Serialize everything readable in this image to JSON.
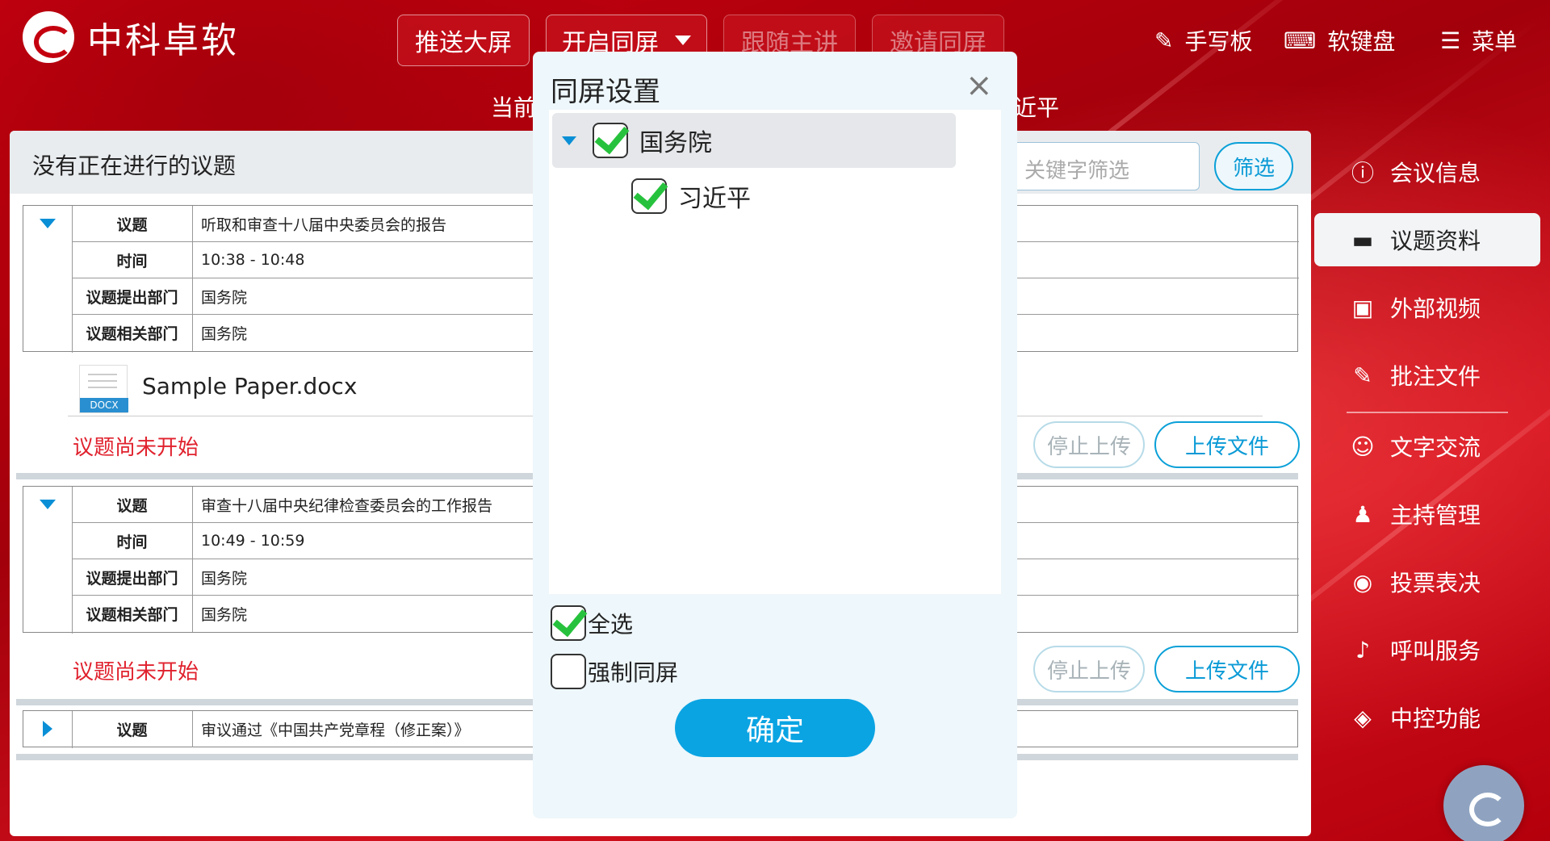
{
  "app": {
    "name": "中科卓软"
  },
  "topbar": {
    "buttons": [
      {
        "label": "推送大屏",
        "enabled": true
      },
      {
        "label": "开启同屏",
        "enabled": true
      },
      {
        "label": "跟随主讲",
        "enabled": false
      },
      {
        "label": "邀请同屏",
        "enabled": false
      }
    ],
    "tools": [
      {
        "label": "手写板",
        "icon": "edit-icon"
      },
      {
        "label": "软键盘",
        "icon": "keyboard-icon"
      },
      {
        "label": "菜单",
        "icon": "menu-icon"
      }
    ],
    "current_prefix": "当前",
    "current_suffix": "近平"
  },
  "panel": {
    "title": "没有正在进行的议题",
    "keyword_placeholder": "关键字筛选",
    "filter_label": "筛选"
  },
  "agenda": {
    "labels": {
      "topic": "议题",
      "time": "时间",
      "proposer": "议题提出部门",
      "related": "议题相关部门"
    },
    "items": [
      {
        "topic": "听取和审查十八届中央委员会的报告",
        "time": "10:38 - 10:48",
        "proposer": "国务院",
        "related": "国务院",
        "file": "Sample Paper.docx",
        "file_type": "DOCX",
        "status": "议题尚未开始"
      },
      {
        "topic": "审查十八届中央纪律检查委员会的工作报告",
        "time": "10:49 - 10:59",
        "proposer": "国务院",
        "related": "国务院",
        "status": "议题尚未开始"
      },
      {
        "topic": "审议通过《中国共产党章程（修正案）》"
      }
    ],
    "stop_upload": "停止上传",
    "upload_file": "上传文件"
  },
  "sidebar": {
    "items": [
      {
        "label": "会议信息",
        "icon": "info-icon"
      },
      {
        "label": "议题资料",
        "icon": "folder-icon",
        "active": true
      },
      {
        "label": "外部视频",
        "icon": "video-icon"
      },
      {
        "label": "批注文件",
        "icon": "annotate-icon"
      },
      {
        "label": "文字交流",
        "icon": "chat-icon"
      },
      {
        "label": "主持管理",
        "icon": "user-icon"
      },
      {
        "label": "投票表决",
        "icon": "vote-icon"
      },
      {
        "label": "呼叫服务",
        "icon": "bell-icon"
      },
      {
        "label": "中控功能",
        "icon": "tag-icon"
      }
    ]
  },
  "modal": {
    "title": "同屏设置",
    "tree": [
      {
        "label": "国务院",
        "checked": true,
        "expanded": true,
        "children": [
          {
            "label": "习近平",
            "checked": true
          }
        ]
      }
    ],
    "select_all": {
      "label": "全选",
      "checked": true
    },
    "force_sync": {
      "label": "强制同屏",
      "checked": false
    },
    "confirm": "确定"
  },
  "colors": {
    "brand_red": "#c4000f",
    "accent_blue": "#0ba4e3",
    "status_red": "#e0222e",
    "check_green": "#27c23d"
  }
}
